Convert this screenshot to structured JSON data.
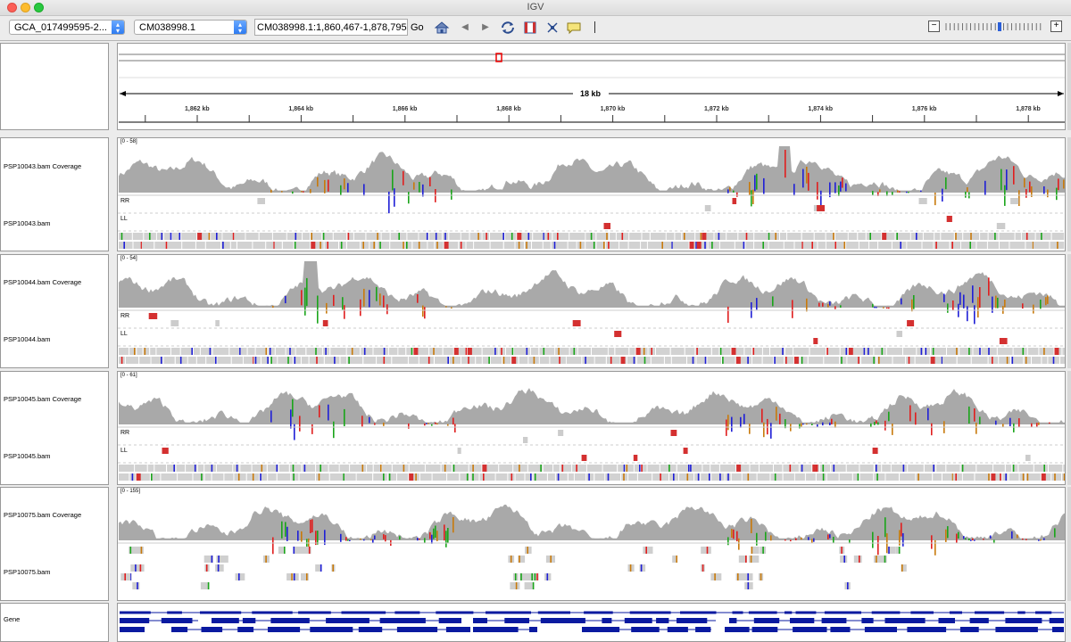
{
  "window": {
    "title": "IGV"
  },
  "toolbar": {
    "genome": "GCA_017499595-2...",
    "chromosome": "CM038998.1",
    "locus": "CM038998.1:1,860,467-1,878,795",
    "go_label": "Go",
    "zoom_out": "−",
    "zoom_in": "+"
  },
  "ruler": {
    "span_label": "18 kb",
    "ticks": [
      "1,862 kb",
      "1,864 kb",
      "1,866 kb",
      "1,868 kb",
      "1,870 kb",
      "1,872 kb",
      "1,874 kb",
      "1,876 kb",
      "1,878 kb"
    ]
  },
  "samples": [
    {
      "coverage_name": "PSP10043.bam Coverage",
      "range": "[0 - 58]",
      "bam_name": "PSP10043.bam",
      "rows": [
        "RR",
        "LL"
      ]
    },
    {
      "coverage_name": "PSP10044.bam Coverage",
      "range": "[0 - 54]",
      "bam_name": "PSP10044.bam",
      "rows": [
        "RR",
        "LL"
      ]
    },
    {
      "coverage_name": "PSP10045.bam Coverage",
      "range": "[0 - 61]",
      "bam_name": "PSP10045.bam",
      "rows": [
        "RR",
        "LL"
      ]
    },
    {
      "coverage_name": "PSP10075.bam Coverage",
      "range": "[0 - 155]",
      "bam_name": "PSP10075.bam",
      "rows": []
    }
  ],
  "gene_track": {
    "name": "Gene"
  },
  "colors": {
    "coverage": "#a9a9a9",
    "A": "#1aa51a",
    "C": "#1f1fd6",
    "G": "#c87a0c",
    "T": "#e01e1e",
    "gene": "#0a1aa0"
  }
}
